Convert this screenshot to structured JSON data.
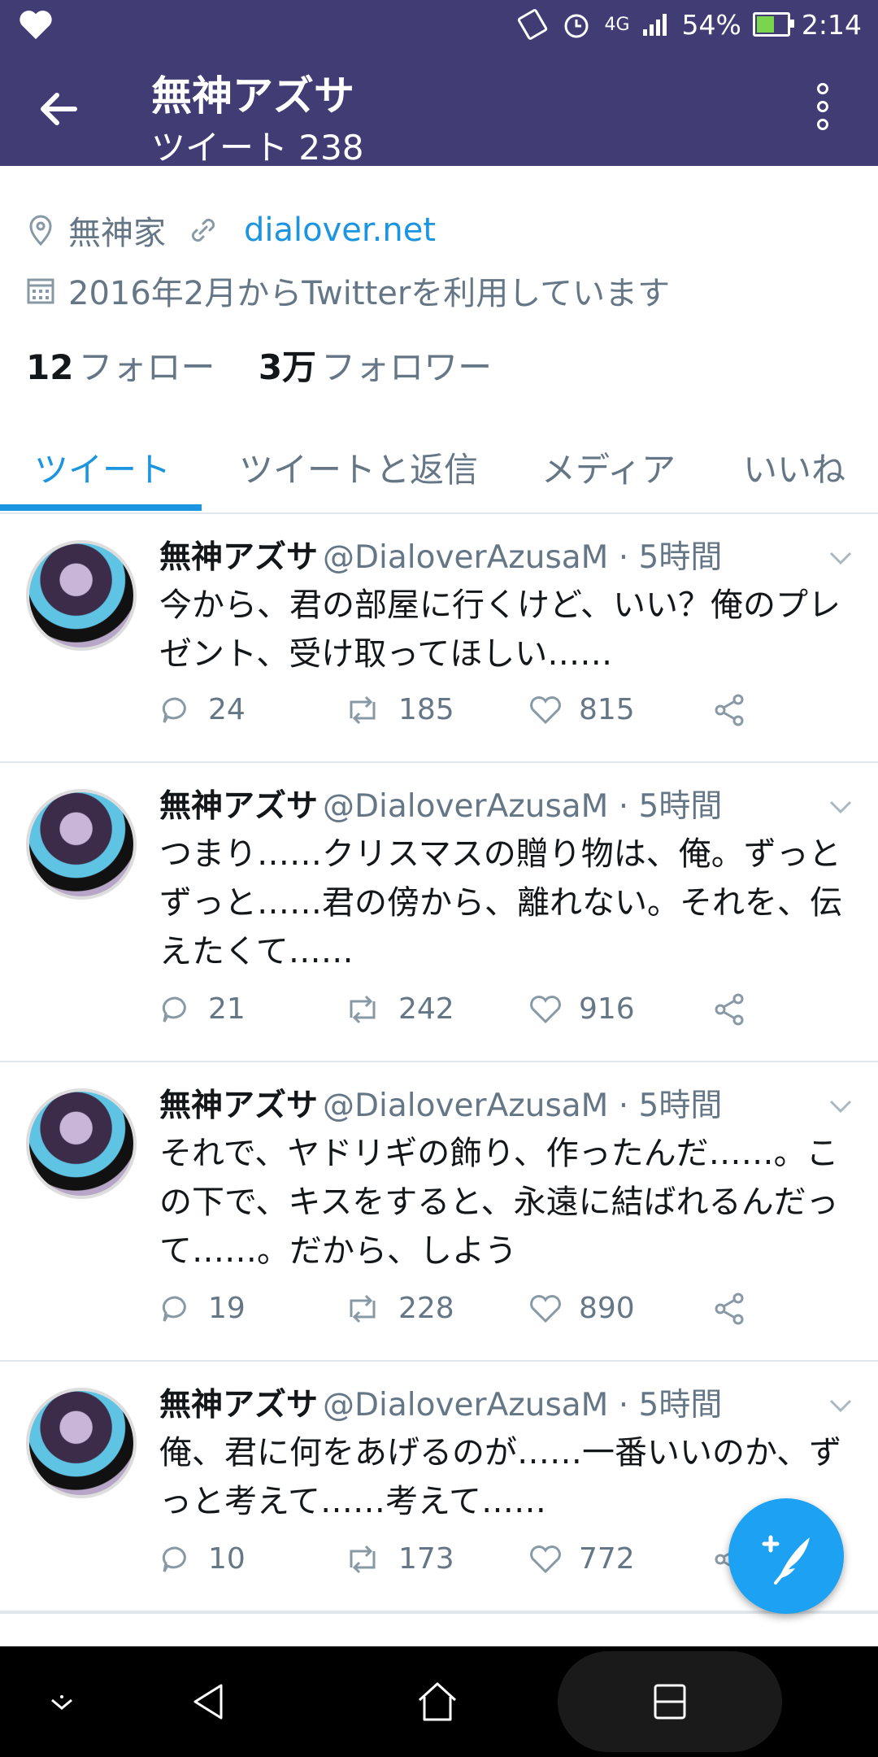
{
  "status_bar": {
    "battery": "54%",
    "time": "2:14",
    "network": "4G"
  },
  "header": {
    "title": "無神アズサ",
    "subtitle": "ツイート 238"
  },
  "profile": {
    "location": "無神家",
    "link": "dialover.net",
    "joined": "2016年2月からTwitterを利用しています",
    "following_count": "12",
    "following_label": "フォロー",
    "followers_count": "3万",
    "followers_label": "フォロワー"
  },
  "tabs": [
    {
      "label": "ツイート"
    },
    {
      "label": "ツイートと返信"
    },
    {
      "label": "メディア"
    },
    {
      "label": "いいね"
    }
  ],
  "tweets": [
    {
      "name": "無神アズサ",
      "handle": "@DialoverAzusaM · 5時間",
      "text": "今から、君の部屋に行くけど、いい？俺のプレゼント、受け取ってほしい……",
      "replies": "24",
      "retweets": "185",
      "likes": "815"
    },
    {
      "name": "無神アズサ",
      "handle": "@DialoverAzusaM · 5時間",
      "text": "つまり……クリスマスの贈り物は、俺。ずっとずっと……君の傍から、離れない。それを、伝えたくて……",
      "replies": "21",
      "retweets": "242",
      "likes": "916"
    },
    {
      "name": "無神アズサ",
      "handle": "@DialoverAzusaM · 5時間",
      "text": "それで、ヤドリギの飾り、作ったんだ……。この下で、キスをすると、永遠に結ばれるんだって……。だから、しよう",
      "replies": "19",
      "retweets": "228",
      "likes": "890"
    },
    {
      "name": "無神アズサ",
      "handle": "@DialoverAzusaM · 5時間",
      "text": "俺、君に何をあげるのが……一番いいのか、ずっと考えて……考えて……",
      "replies": "10",
      "retweets": "173",
      "likes": "772"
    }
  ],
  "colors": {
    "header_bg": "#413d74",
    "accent": "#1b95e0",
    "fab": "#1da1f2"
  }
}
